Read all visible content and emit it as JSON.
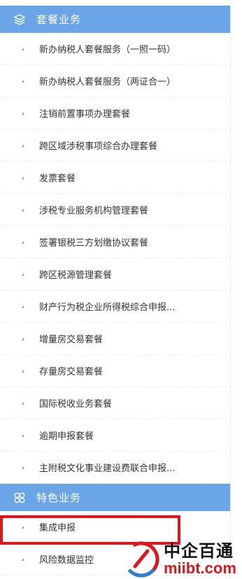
{
  "sections": [
    {
      "title": "套餐业务",
      "icon": "layers-icon",
      "items": [
        "新办纳税人套餐服务（一照一码）",
        "新办纳税人套餐服务（两证合一）",
        "注销前置事项办理套餐",
        "跨区域涉税事项综合办理套餐",
        "发票套餐",
        "涉税专业服务机构管理套餐",
        "签署银税三方划缴协议套餐",
        "跨区税源管理套餐",
        "财产行为税企业所得税综合申报...",
        "增量房交易套餐",
        "存量房交易套餐",
        "国际税收业务套餐",
        "逾期申报套餐",
        "主附税文化事业建设费联合申报..."
      ]
    },
    {
      "title": "特色业务",
      "icon": "clover-icon",
      "items": [
        "集成申报",
        "风险数据监控"
      ]
    }
  ],
  "highlighted_item": "集成申报",
  "watermark": {
    "brand_cn": "中企百通",
    "brand_en": "miibt.com",
    "logo_colors": [
      "#e0161d",
      "#2f7fd0"
    ]
  }
}
